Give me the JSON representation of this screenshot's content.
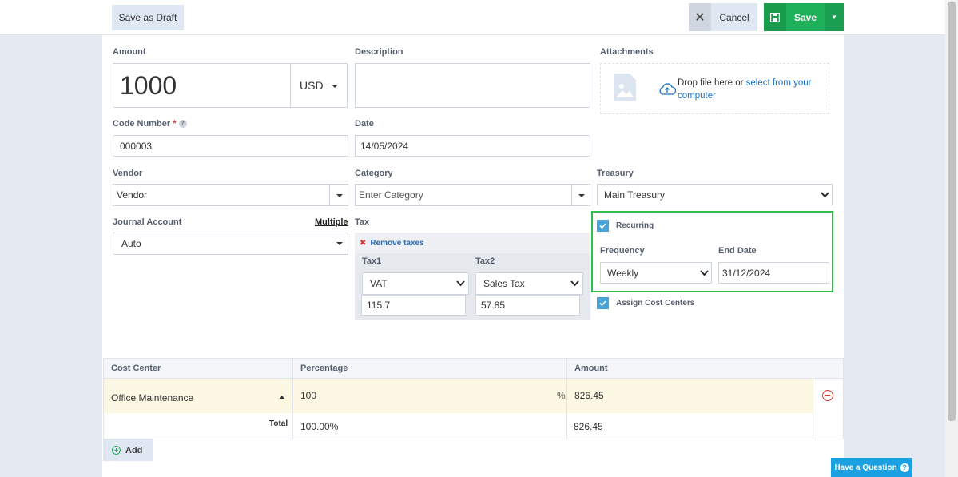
{
  "toolbar": {
    "save_draft_label": "Save as Draft",
    "cancel_label": "Cancel",
    "save_label": "Save"
  },
  "form": {
    "amount": {
      "label": "Amount",
      "value": "1000",
      "currency": "USD"
    },
    "description": {
      "label": "Description",
      "value": ""
    },
    "attachments": {
      "label": "Attachments",
      "drop_text": "Drop file here or ",
      "select_link": "select from your",
      "select_link_2": "computer"
    },
    "code_number": {
      "label": "Code Number",
      "required_mark": "*",
      "help": "?",
      "value": "000003"
    },
    "date": {
      "label": "Date",
      "value": "14/05/2024"
    },
    "vendor": {
      "label": "Vendor",
      "value": "Vendor"
    },
    "category": {
      "label": "Category",
      "placeholder": "Enter Category"
    },
    "treasury": {
      "label": "Treasury",
      "value": "Main Treasury"
    },
    "journal_account": {
      "label": "Journal Account",
      "multiple_link": "Multiple",
      "value": "Auto"
    },
    "tax": {
      "label": "Tax",
      "remove_label": "Remove taxes",
      "tax1": {
        "label": "Tax1",
        "value": "VAT",
        "amount": "115.7"
      },
      "tax2": {
        "label": "Tax2",
        "value": "Sales Tax",
        "amount": "57.85"
      }
    },
    "recurring": {
      "label": "Recurring",
      "checked": true,
      "frequency": {
        "label": "Frequency",
        "value": "Weekly"
      },
      "end_date": {
        "label": "End Date",
        "value": "31/12/2024"
      }
    },
    "assign_cost_centers": {
      "label": "Assign Cost Centers",
      "checked": true
    }
  },
  "cost_table": {
    "headers": [
      "Cost Center",
      "Percentage",
      "Amount"
    ],
    "rows": [
      {
        "cost_center": "Office Maintenance",
        "percentage": "100",
        "percent_sign": "%",
        "amount": "826.45"
      }
    ],
    "total": {
      "label": "Total",
      "percentage": "100.00%",
      "amount": "826.45"
    },
    "add_label": "Add"
  },
  "help_button": {
    "label": "Have a Question",
    "icon": "question-icon"
  },
  "colors": {
    "accent_green": "#1fb15a",
    "recurring_border": "#2fbf4a",
    "link_blue": "#1a73c8",
    "help_blue": "#1ba1e2"
  }
}
